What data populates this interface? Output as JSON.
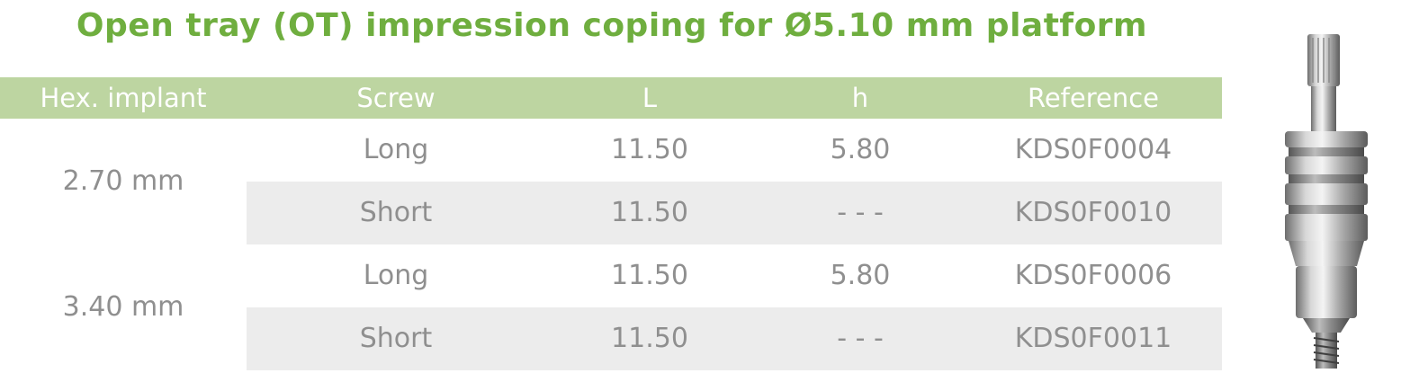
{
  "title": "Open tray (OT) impression coping for Ø5.10 mm platform",
  "headers": {
    "implant": "Hex. implant",
    "screw": "Screw",
    "l": "L",
    "h": "h",
    "reference": "Reference"
  },
  "groups": [
    {
      "implant": "2.70 mm",
      "rows": [
        {
          "screw": "Long",
          "l": "11.50",
          "h": "5.80",
          "reference": "KDS0F0004"
        },
        {
          "screw": "Short",
          "l": "11.50",
          "h": "- - -",
          "reference": "KDS0F0010"
        }
      ]
    },
    {
      "implant": "3.40 mm",
      "rows": [
        {
          "screw": "Long",
          "l": "11.50",
          "h": "5.80",
          "reference": "KDS0F0006"
        },
        {
          "screw": "Short",
          "l": "11.50",
          "h": "- - -",
          "reference": "KDS0F0011"
        }
      ]
    }
  ],
  "colors": {
    "title": "#6fae3f",
    "header_bg": "#bdd5a1",
    "header_text": "#ffffff",
    "body_text": "#8f8f8f",
    "row_shade": "#ececec"
  },
  "image": {
    "icon": "impression-coping-product-image"
  }
}
